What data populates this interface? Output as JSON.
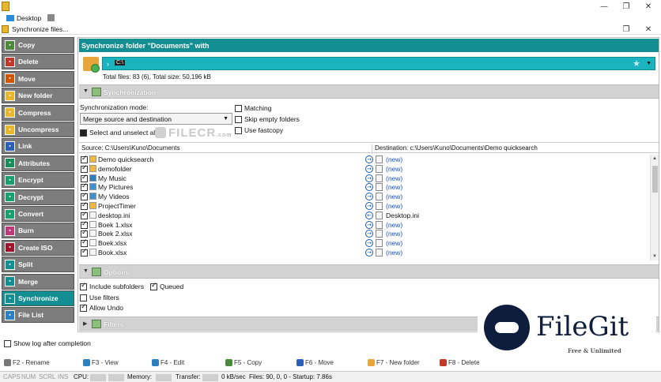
{
  "window": {
    "desktop_label": "Desktop",
    "subtitle": "Synchronize files...",
    "controls": {
      "minimize": "—",
      "restore": "❐",
      "close": "✕"
    }
  },
  "sidebar": {
    "items": [
      {
        "label": "Copy",
        "color": "#4a8a3a"
      },
      {
        "label": "Delete",
        "color": "#c0392b"
      },
      {
        "label": "Move",
        "color": "#d35400"
      },
      {
        "label": "New folder",
        "color": "#e8b72e"
      },
      {
        "label": "Compress",
        "color": "#e8b72e"
      },
      {
        "label": "Uncompress",
        "color": "#e8b72e"
      },
      {
        "label": "Link",
        "color": "#2c5fb8"
      },
      {
        "label": "Attributes",
        "color": "#1a8e5a"
      },
      {
        "label": "Encrypt",
        "color": "#1aa070"
      },
      {
        "label": "Decrypt",
        "color": "#1aa070"
      },
      {
        "label": "Convert",
        "color": "#1aa070"
      },
      {
        "label": "Burn",
        "color": "#c0397b"
      },
      {
        "label": "Create ISO",
        "color": "#a0142a"
      },
      {
        "label": "Split",
        "color": "#138e93"
      },
      {
        "label": "Merge",
        "color": "#138e93"
      },
      {
        "label": "Synchronize",
        "color": "#138e93",
        "active": true
      },
      {
        "label": "File List",
        "color": "#2c7fc0"
      }
    ]
  },
  "main": {
    "header": "Synchronize folder \"Documents\" with",
    "destination_drive": "C:\\",
    "totals": "Total files: 83 (6), Total size: 50,196 kB",
    "sync_section": "Synchronization",
    "sync_mode_label": "Synchronization mode:",
    "sync_mode_value": "Merge source and destination",
    "select_all_label": "Select and unselect all",
    "matching_label": "Matching",
    "skip_empty_label": "Skip empty folders",
    "fastcopy_label": "Use fastcopy",
    "source_path": "Source: C:\\Users\\Kuno\\Documents",
    "dest_path": "Destination: c:\\Users\\Kuno\\Documents\\Demo quicksearch",
    "files": [
      {
        "name": "Demo quicksearch",
        "icon": "folder-icon",
        "dir": "→",
        "dest": "(new)",
        "new": true
      },
      {
        "name": "demofolder",
        "icon": "folder-icon",
        "dir": "→",
        "dest": "(new)",
        "new": true
      },
      {
        "name": "My Music",
        "icon": "music-icon",
        "dir": "→",
        "dest": "(new)",
        "new": true
      },
      {
        "name": "My Pictures",
        "icon": "pictures-icon",
        "dir": "→",
        "dest": "(new)",
        "new": true
      },
      {
        "name": "My Videos",
        "icon": "videos-icon",
        "dir": "→",
        "dest": "(new)",
        "new": true
      },
      {
        "name": "ProjectTimer",
        "icon": "folder-icon",
        "dir": "→",
        "dest": "(new)",
        "new": true
      },
      {
        "name": "desktop.ini",
        "icon": "file-icon",
        "dir": "←",
        "dest": "Desktop.ini",
        "new": false
      },
      {
        "name": "Boek 1.xlsx",
        "icon": "file-icon",
        "dir": "→",
        "dest": "(new)",
        "new": true
      },
      {
        "name": "Boek 2.xlsx",
        "icon": "file-icon",
        "dir": "→",
        "dest": "(new)",
        "new": true
      },
      {
        "name": "Boek.xlsx",
        "icon": "file-icon",
        "dir": "→",
        "dest": "(new)",
        "new": true
      },
      {
        "name": "Book.xlsx",
        "icon": "file-icon",
        "dir": "→",
        "dest": "(new)",
        "new": true
      }
    ],
    "options_section": "Options",
    "include_subfolders": "Include subfolders",
    "queued": "Queued",
    "use_filters": "Use filters",
    "allow_undo": "Allow Undo",
    "filters_section": "Filters"
  },
  "watermark": {
    "text": "FILECR",
    "suffix": ".com"
  },
  "filegit": {
    "name": "FileGit",
    "tagline": "Free & Unlimited"
  },
  "show_log_label": "Show log after completion",
  "fkeys": [
    {
      "label": "F2 - Rename",
      "color": "#777"
    },
    {
      "label": "F3 - View",
      "color": "#2c7fc0"
    },
    {
      "label": "F4 - Edit",
      "color": "#2c7fc0"
    },
    {
      "label": "F5 - Copy",
      "color": "#4a8a3a"
    },
    {
      "label": "F6 - Move",
      "color": "#2c5fb8"
    },
    {
      "label": "F7 - New folder",
      "color": "#e8a53a"
    },
    {
      "label": "F8 - Delete",
      "color": "#c0392b"
    }
  ],
  "status": {
    "caps": "CAPS",
    "num": "NUM",
    "scrl": "SCRL",
    "ins": "INS",
    "cpu": "CPU:",
    "memory": "Memory:",
    "transfer": "Transfer:",
    "rate": "0 kB/sec",
    "files": "Files: 90, 0, 0 - Startup: 7.86s"
  }
}
